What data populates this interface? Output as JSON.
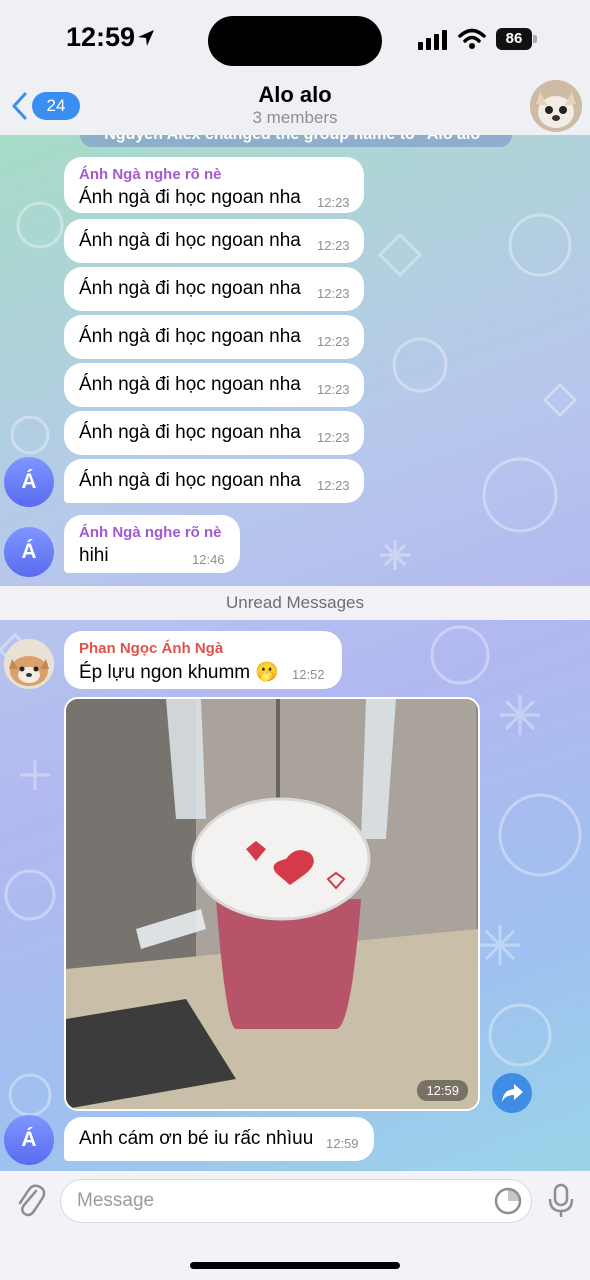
{
  "status": {
    "time": "12:59",
    "battery": "86"
  },
  "header": {
    "back_count": "24",
    "title": "Alo alo",
    "subtitle": "3 members"
  },
  "service_message": "Nguyen Alex changed the group name to \"Alo alo\"",
  "messages": [
    {
      "sender": "Ánh Ngà nghe rõ nè",
      "text": "Ánh ngà đi học ngoan nha",
      "time": "12:23"
    },
    {
      "text": "Ánh ngà đi học ngoan nha",
      "time": "12:23"
    },
    {
      "text": "Ánh ngà đi học ngoan nha",
      "time": "12:23"
    },
    {
      "text": "Ánh ngà đi học ngoan nha",
      "time": "12:23"
    },
    {
      "text": "Ánh ngà đi học ngoan nha",
      "time": "12:23"
    },
    {
      "text": "Ánh ngà đi học ngoan nha",
      "time": "12:23"
    },
    {
      "text": "Ánh ngà đi học ngoan nha",
      "time": "12:23"
    },
    {
      "sender": "Ánh Ngà nghe rõ nè",
      "text": "hihi",
      "time": "12:46"
    }
  ],
  "unread_label": "Unread Messages",
  "phan_message": {
    "sender": "Phan Ngọc Ánh Ngà",
    "text": "Ép lựu ngon khumm 🫢",
    "time": "12:52"
  },
  "photo_time": "12:59",
  "last_message": {
    "text": "Anh cám ơn bé iu rấc nhìuu",
    "time": "12:59"
  },
  "avatar_letter": "Á",
  "input": {
    "placeholder": "Message"
  },
  "colors": {
    "accent": "#3a8ef0",
    "sender_name": "#a35ad1",
    "phan_name": "#e0524a",
    "avatar": "#6a7df5"
  }
}
